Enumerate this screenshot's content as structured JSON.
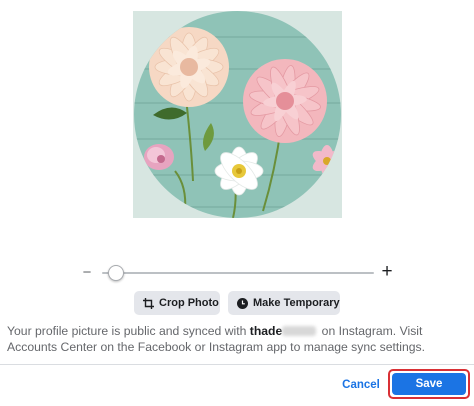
{
  "image": {
    "description_icon": "profile-photo-flowers"
  },
  "zoom": {
    "minus_label": "−",
    "plus_label": "+",
    "level": 0.05
  },
  "actions": {
    "crop_label": "Crop Photo",
    "crop_icon": "crop-icon",
    "temporary_label": "Make Temporary",
    "temporary_icon": "clock-icon"
  },
  "sync_notice": {
    "prefix": "Your profile picture is public and synced with",
    "username": "thade",
    "suffix": "on Instagram. Visit Accounts Center on the Facebook or Instagram app to manage sync settings."
  },
  "footer": {
    "cancel_label": "Cancel",
    "save_label": "Save"
  },
  "colors": {
    "accent": "#1b74e4",
    "highlight_outline": "#d93035",
    "chip_bg": "#e4e6eb"
  }
}
